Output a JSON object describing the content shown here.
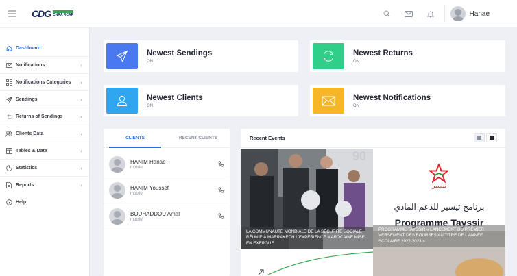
{
  "header": {
    "logo": {
      "brand": "CDG",
      "sub": "CNRA RCAR"
    },
    "user_name": "Hanae",
    "icons": [
      "search-icon",
      "mail-icon",
      "bell-icon"
    ]
  },
  "sidebar": {
    "items": [
      {
        "label": "Dashboard",
        "icon": "home-icon",
        "active": true,
        "chevron": ""
      },
      {
        "label": "Notifications",
        "icon": "mail-icon",
        "chevron": "‹"
      },
      {
        "label": "Notifications Categories",
        "icon": "grid-icon",
        "chevron": "‹"
      },
      {
        "label": "Sendings",
        "icon": "send-icon",
        "chevron": "‹"
      },
      {
        "label": "Returns of Sendings",
        "icon": "return-icon",
        "chevron": "‹"
      },
      {
        "label": "Clients Data",
        "icon": "users-icon",
        "chevron": "‹"
      },
      {
        "label": "Tables & Data",
        "icon": "table-icon",
        "chevron": "‹"
      },
      {
        "label": "Statistics",
        "icon": "pie-icon",
        "chevron": "‹"
      },
      {
        "label": "Reports",
        "icon": "file-icon",
        "chevron": "‹"
      },
      {
        "label": "Help",
        "icon": "help-icon",
        "chevron": ""
      }
    ]
  },
  "stats": [
    {
      "title": "Newest Sendings",
      "sub": "ON",
      "color": "#4a78f0"
    },
    {
      "title": "Newest Returns",
      "sub": "ON",
      "color": "#2fcf8a"
    },
    {
      "title": "Newest Clients",
      "sub": "ON",
      "color": "#2fa6ef"
    },
    {
      "title": "Newest Notifications",
      "sub": "ON",
      "color": "#f6b727"
    }
  ],
  "clients": {
    "tabs": [
      "CLIENTS",
      "RECENT CLIENTS"
    ],
    "list": [
      {
        "name": "HANIM Hanae",
        "role": "mobile"
      },
      {
        "name": "HANIM Youssef",
        "role": "mobile"
      },
      {
        "name": "BOUHADDOU Amal",
        "role": "mobile"
      }
    ]
  },
  "events": {
    "title": "Recent Events",
    "items": [
      {
        "caption": "LA COMMUNAUTÉ MONDIALE DE LA SÉCURITÉ SOCIALE RÉUNIE À MARRAKECH L'EXPÉRIENCE MAROCAINE MISE EN EXERGUE",
        "badge": "90"
      },
      {
        "caption": "PROGRAMME TAYSSIR « LANCEMENT DU PREMIER VERSEMENT DES BOURSES AU TITRE DE L'ANNÉE SCOLAIRE 2022-2023 »",
        "logo_ar": "تيسير",
        "line_ar": "برنامج تيسير للدعم المادي",
        "line_fr": "Programme Tayssir"
      }
    ]
  }
}
